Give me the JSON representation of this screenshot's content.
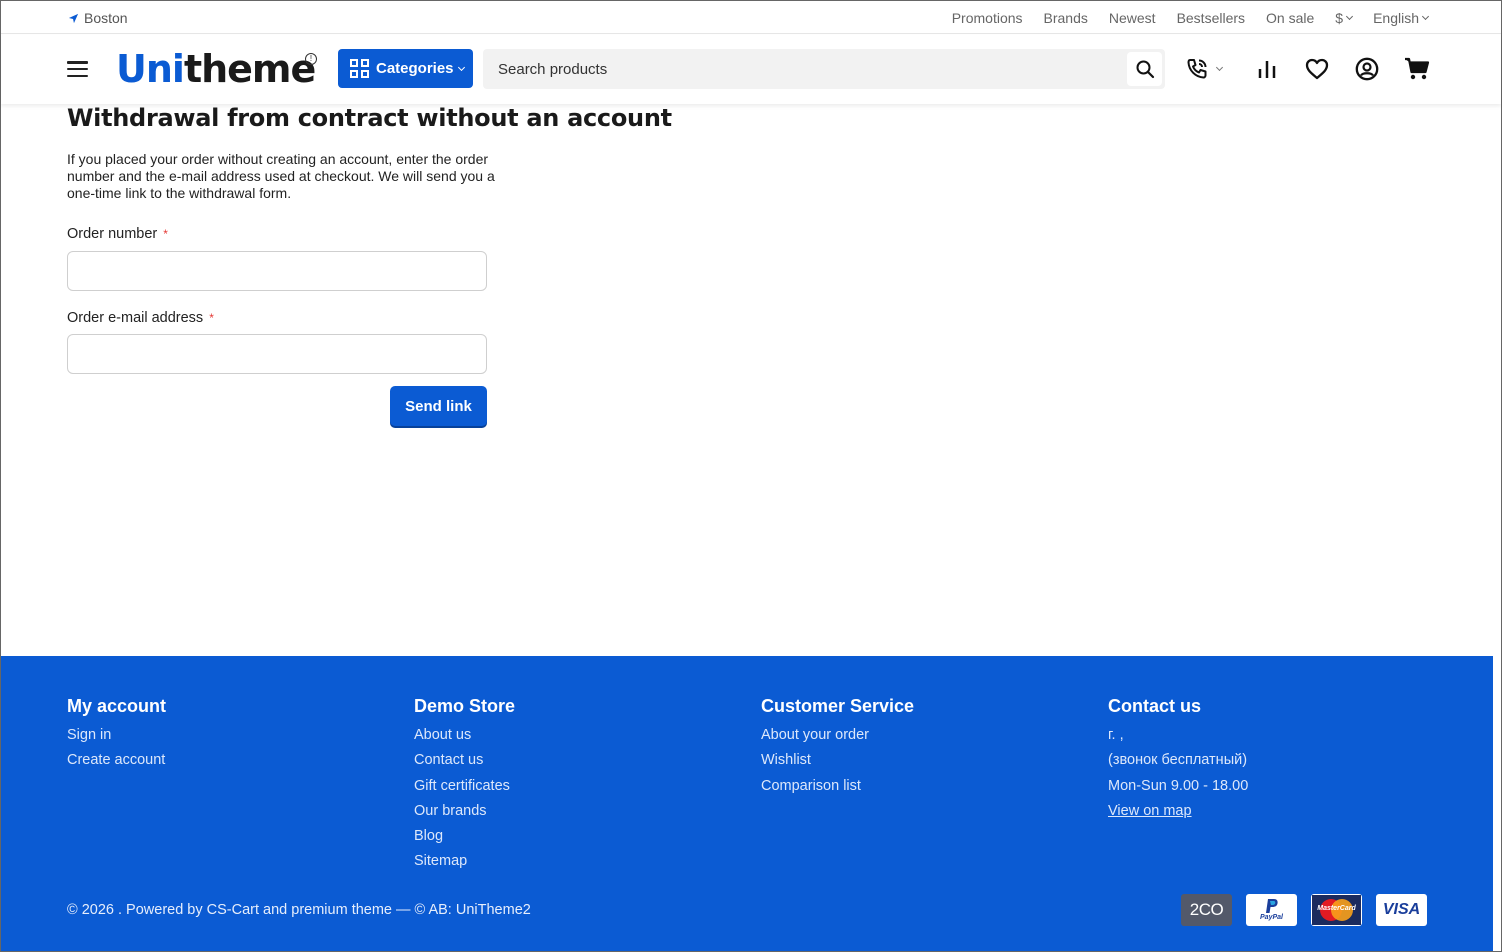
{
  "topbar": {
    "location": "Boston",
    "links": [
      "Promotions",
      "Brands",
      "Newest",
      "Bestsellers",
      "On sale"
    ],
    "currency": "$",
    "language": "English"
  },
  "header": {
    "logo_part1": "Uni",
    "logo_part2": "theme",
    "categories_label": "Categories",
    "search_placeholder": "Search products"
  },
  "main": {
    "title": "Withdrawal from contract without an account",
    "intro": "If you placed your order without creating an account, enter the order number and the e-mail address used at checkout. We will send you a one-time link to the withdrawal form.",
    "order_number_label": "Order number",
    "order_email_label": "Order e-mail address",
    "required_mark": "*",
    "order_number_value": "",
    "order_email_value": "",
    "submit_label": "Send link"
  },
  "footer": {
    "columns": [
      {
        "title": "My account",
        "items": [
          "Sign in",
          "Create account"
        ]
      },
      {
        "title": "Demo Store",
        "items": [
          "About us",
          "Contact us",
          "Gift certificates",
          "Our brands",
          "Blog",
          "Sitemap"
        ]
      },
      {
        "title": "Customer Service",
        "items": [
          "About your order",
          "Wishlist",
          "Comparison list"
        ]
      },
      {
        "title": "Contact us",
        "items": [
          "г. ,",
          "(звонок бесплатный)",
          "Mon-Sun 9.00 - 18.00",
          "View on map"
        ]
      }
    ],
    "copyright": "© 2026 . Powered by CS-Cart and premium theme — © AB: UniTheme2",
    "payments": [
      "2CO",
      "PayPal",
      "MasterCard",
      "VISA"
    ]
  },
  "colors": {
    "brand": "#0b5bd3",
    "required": "#e53935"
  }
}
